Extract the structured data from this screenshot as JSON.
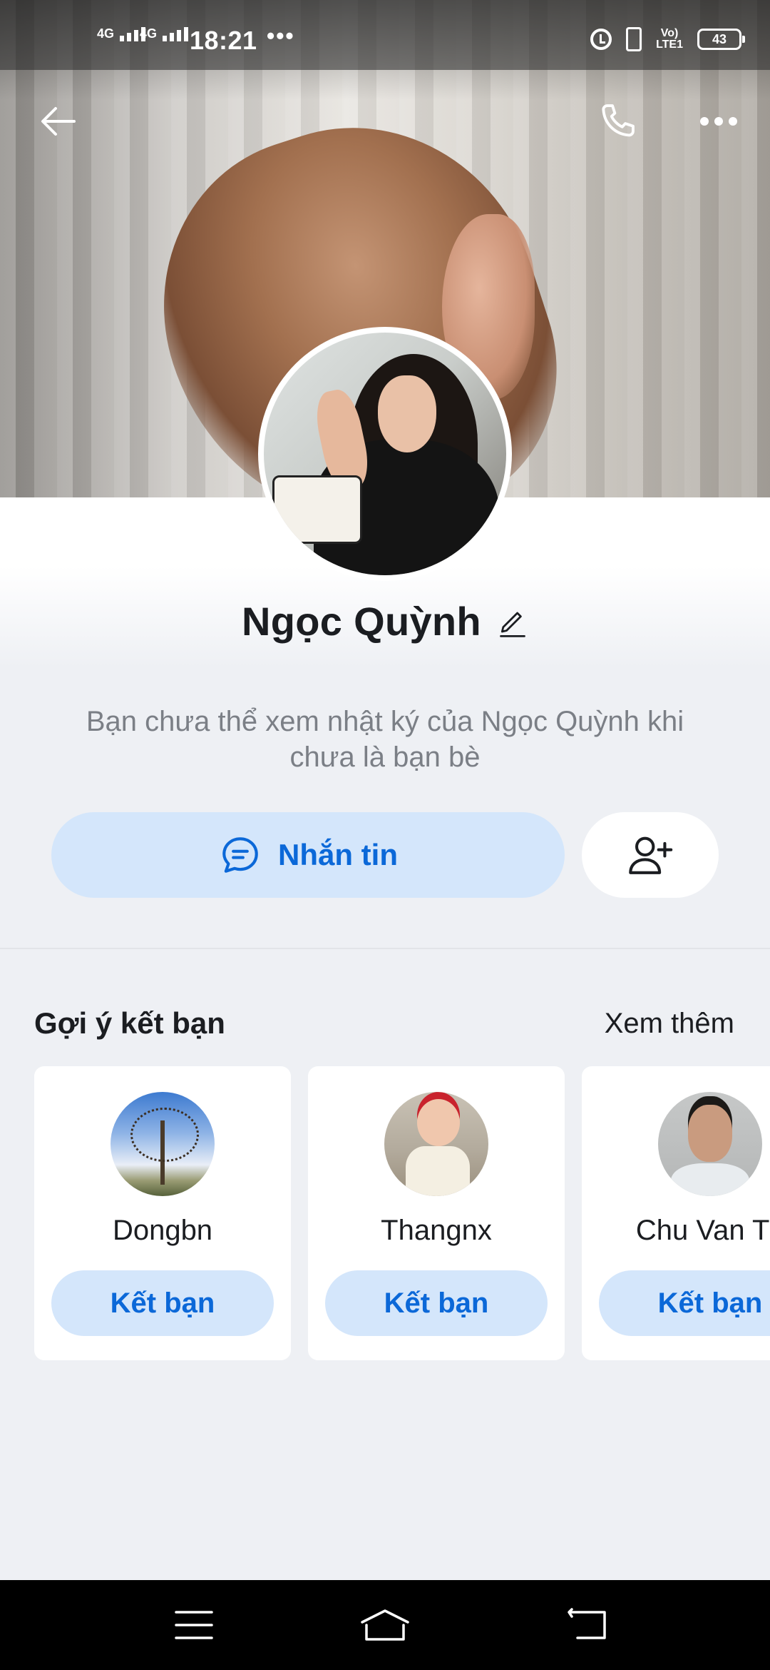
{
  "status_bar": {
    "network_1": "4G",
    "network_2": "4G",
    "time": "18:21",
    "more": "•••",
    "volte": "VoLTE1",
    "battery": "43"
  },
  "top_nav": {
    "back_icon": "arrow-left-icon",
    "call_icon": "phone-icon",
    "more_icon": "more-horizontal-icon"
  },
  "profile": {
    "name": "Ngọc Quỳnh",
    "notice": "Bạn chưa thể xem nhật ký của Ngọc Quỳnh khi chưa là bạn bè",
    "message_button": "Nhắn tin"
  },
  "suggestions": {
    "title": "Gợi ý kết bạn",
    "see_more": "Xem thêm",
    "items": [
      {
        "name": "Dongbn",
        "button": "Kết bạn"
      },
      {
        "name": "Thangnx",
        "button": "Kết bạn"
      },
      {
        "name": "Chu Van Tri",
        "button": "Kết bạn"
      }
    ]
  },
  "colors": {
    "accent": "#0b68d8",
    "accent_light": "#d4e6fb",
    "background": "#eef0f4"
  }
}
